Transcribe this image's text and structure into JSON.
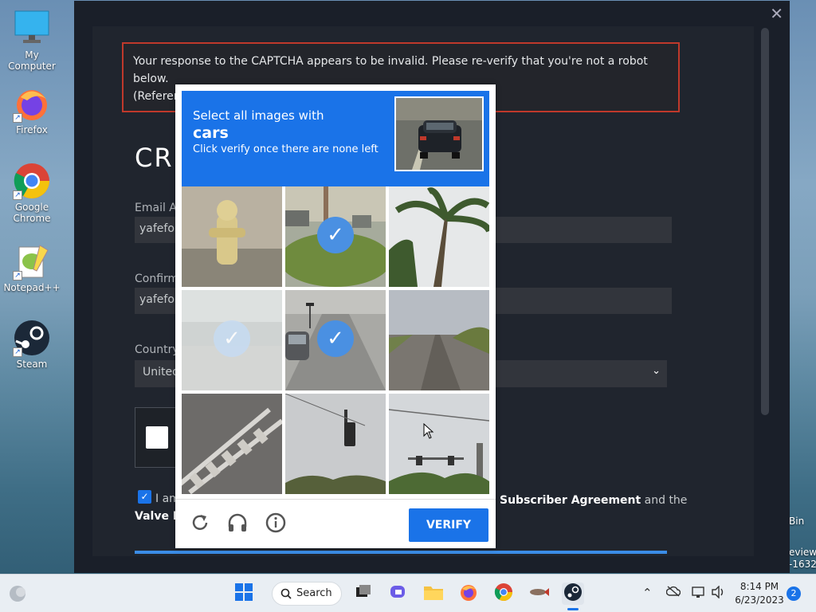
{
  "desktop": {
    "icons": [
      {
        "label": "My Computer"
      },
      {
        "label": "Firefox"
      },
      {
        "label": "Google Chrome"
      },
      {
        "label": "Notepad++"
      },
      {
        "label": "Steam"
      }
    ],
    "right_labels": [
      "Bin",
      "eview",
      "-1632"
    ]
  },
  "steam": {
    "error_line1": "Your response to the CAPTCHA appears to be invalid. Please re-verify that you're not a robot",
    "error_line2": "below.",
    "error_line3": "(Referen",
    "title": "CR",
    "email_label": "Email Ac",
    "email_value": "yafefo5",
    "confirm_label": "Confirm",
    "confirm_value": "yafefo5",
    "country_label": "Country",
    "country_value": "United",
    "agree_text": "I am",
    "agree_line2": "Valve Pr",
    "subscriber_text": "Subscriber Agreement",
    "and_the": "and the",
    "close_glyph": "✕"
  },
  "captcha": {
    "instruction": "Select all images with",
    "target": "cars",
    "hint": "Click verify once there are none left",
    "verify_label": "VERIFY",
    "selected_tiles": [
      1,
      3,
      4
    ],
    "faded_tiles": [
      3
    ]
  },
  "taskbar": {
    "search_label": "Search",
    "time": "8:14 PM",
    "date": "6/23/2023",
    "notification_count": "2"
  },
  "colors": {
    "captcha_blue": "#1a73e8",
    "error_red": "#c0392b",
    "steam_bg": "#1a1f29"
  }
}
